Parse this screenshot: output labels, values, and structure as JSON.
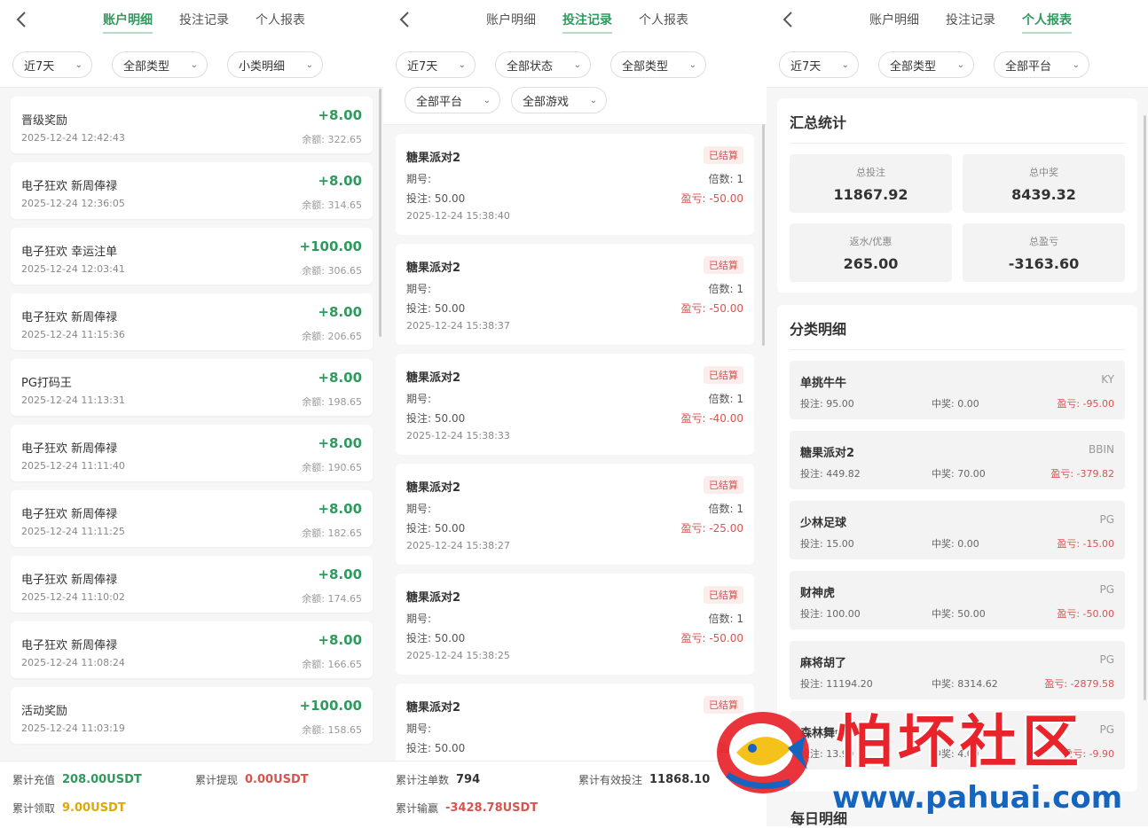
{
  "tabs": [
    "账户明细",
    "投注记录",
    "个人报表"
  ],
  "panel1": {
    "filters": [
      "近7天",
      "全部类型",
      "小类明细"
    ],
    "items": [
      {
        "name": "晋级奖励",
        "time": "2025-12-24 12:42:43",
        "amount": "+8.00",
        "balance": "余额: 322.65"
      },
      {
        "name": "电子狂欢 新周俸禄",
        "time": "2025-12-24 12:36:05",
        "amount": "+8.00",
        "balance": "余额: 314.65"
      },
      {
        "name": "电子狂欢 幸运注单",
        "time": "2025-12-24 12:03:41",
        "amount": "+100.00",
        "balance": "余额: 306.65"
      },
      {
        "name": "电子狂欢 新周俸禄",
        "time": "2025-12-24 11:15:36",
        "amount": "+8.00",
        "balance": "余额: 206.65"
      },
      {
        "name": "PG打码王",
        "time": "2025-12-24 11:13:31",
        "amount": "+8.00",
        "balance": "余额: 198.65"
      },
      {
        "name": "电子狂欢 新周俸禄",
        "time": "2025-12-24 11:11:40",
        "amount": "+8.00",
        "balance": "余额: 190.65"
      },
      {
        "name": "电子狂欢 新周俸禄",
        "time": "2025-12-24 11:11:25",
        "amount": "+8.00",
        "balance": "余额: 182.65"
      },
      {
        "name": "电子狂欢 新周俸禄",
        "time": "2025-12-24 11:10:02",
        "amount": "+8.00",
        "balance": "余额: 174.65"
      },
      {
        "name": "电子狂欢 新周俸禄",
        "time": "2025-12-24 11:08:24",
        "amount": "+8.00",
        "balance": "余额: 166.65"
      },
      {
        "name": "活动奖励",
        "time": "2025-12-24 11:03:19",
        "amount": "+100.00",
        "balance": "余额: 158.65"
      }
    ],
    "footer": {
      "deposit_label": "累计充值",
      "deposit_value": "208.00USDT",
      "withdraw_label": "累计提现",
      "withdraw_value": "0.00USDT",
      "claim_label": "累计领取",
      "claim_value": "9.00USDT"
    }
  },
  "panel2": {
    "filters": [
      "近7天",
      "全部状态",
      "全部类型",
      "全部平台",
      "全部游戏"
    ],
    "bets": [
      {
        "name": "糖果派对2",
        "status": "已结算",
        "issue": "期号:",
        "multiplier": "倍数: 1",
        "stake": "投注: 50.00",
        "pl_label": "盈亏:",
        "pl": "-50.00",
        "time": "2025-12-24 15:38:40"
      },
      {
        "name": "糖果派对2",
        "status": "已结算",
        "issue": "期号:",
        "multiplier": "倍数: 1",
        "stake": "投注: 50.00",
        "pl_label": "盈亏:",
        "pl": "-50.00",
        "time": "2025-12-24 15:38:37"
      },
      {
        "name": "糖果派对2",
        "status": "已结算",
        "issue": "期号:",
        "multiplier": "倍数: 1",
        "stake": "投注: 50.00",
        "pl_label": "盈亏:",
        "pl": "-40.00",
        "time": "2025-12-24 15:38:33"
      },
      {
        "name": "糖果派对2",
        "status": "已结算",
        "issue": "期号:",
        "multiplier": "倍数: 1",
        "stake": "投注: 50.00",
        "pl_label": "盈亏:",
        "pl": "-25.00",
        "time": "2025-12-24 15:38:27"
      },
      {
        "name": "糖果派对2",
        "status": "已结算",
        "issue": "期号:",
        "multiplier": "倍数: 1",
        "stake": "投注: 50.00",
        "pl_label": "盈亏:",
        "pl": "-50.00",
        "time": "2025-12-24 15:38:25"
      },
      {
        "name": "糖果派对2",
        "status": "已结算",
        "issue": "期号:",
        "multiplier": "",
        "stake": "投注: 50.00",
        "pl_label": "盈亏:",
        "pl": "",
        "time": ""
      }
    ],
    "footer": {
      "count_label": "累计注单数",
      "count_value": "794",
      "valid_label": "累计有效投注",
      "valid_value": "11868.10",
      "winloss_label": "累计输赢",
      "winloss_value": "-3428.78USDT"
    }
  },
  "panel3": {
    "filters": [
      "近7天",
      "全部类型",
      "全部平台"
    ],
    "summary_title": "汇总统计",
    "stats": [
      {
        "label": "总投注",
        "value": "11867.92"
      },
      {
        "label": "总中奖",
        "value": "8439.32"
      },
      {
        "label": "返水/优惠",
        "value": "265.00"
      },
      {
        "label": "总盈亏",
        "value": "-3163.60"
      }
    ],
    "category_title": "分类明细",
    "categories": [
      {
        "name": "单挑牛牛",
        "platform": "KY",
        "bet": "投注: 95.00",
        "win": "中奖: 0.00",
        "pl": "盈亏: -95.00"
      },
      {
        "name": "糖果派对2",
        "platform": "BBIN",
        "bet": "投注: 449.82",
        "win": "中奖: 70.00",
        "pl": "盈亏: -379.82"
      },
      {
        "name": "少林足球",
        "platform": "PG",
        "bet": "投注: 15.00",
        "win": "中奖: 0.00",
        "pl": "盈亏: -15.00"
      },
      {
        "name": "财神虎",
        "platform": "PG",
        "bet": "投注: 100.00",
        "win": "中奖: 50.00",
        "pl": "盈亏: -50.00"
      },
      {
        "name": "麻将胡了",
        "platform": "PG",
        "bet": "投注: 11194.20",
        "win": "中奖: 8314.62",
        "pl": "盈亏: -2879.58"
      },
      {
        "name": "森林舞会",
        "platform": "PG",
        "bet": "投注: 13.90",
        "win": "中奖: 4.00",
        "pl": "盈亏: -9.90"
      }
    ],
    "daily_title": "每日明细"
  },
  "watermark": {
    "text": "怕坏社区",
    "url": "www.pahuai.com"
  },
  "colors": {
    "accent": "#2e9a5d",
    "loss": "#d9534f",
    "gold": "#e0a800",
    "rebate": "#2b8cc4"
  }
}
